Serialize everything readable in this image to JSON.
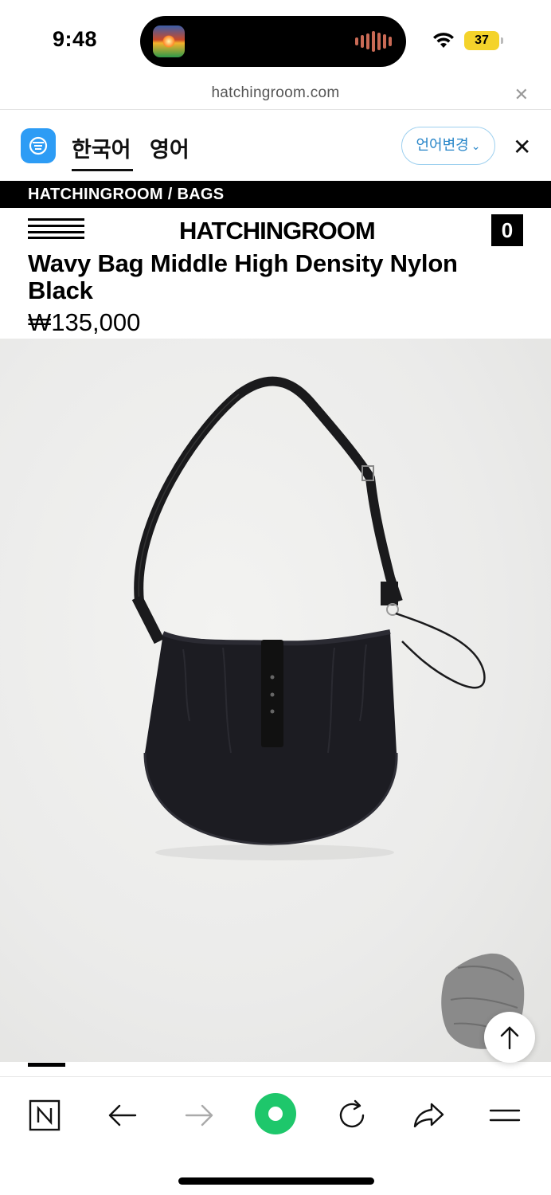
{
  "status_bar": {
    "time": "9:48",
    "battery_level": "37",
    "icons": [
      "music-app-icon",
      "audio-waveform-icon",
      "wifi-icon",
      "battery-icon"
    ],
    "battery_color": "#f4d32b"
  },
  "browser": {
    "url": "hatchingroom.com",
    "close_icon": "close-icon"
  },
  "translate_bar": {
    "app_icon": "papago-translate-icon",
    "tabs": [
      {
        "label": "한국어",
        "active": true
      },
      {
        "label": "영어",
        "active": false
      }
    ],
    "change_language_label": "언어변경",
    "accent_color": "#2886c9"
  },
  "site": {
    "breadcrumb": "HATCHINGROOM / BAGS",
    "logo": "HATCHINGROOM",
    "cart_count": "0"
  },
  "product": {
    "title": "Wavy Bag Middle High Density Nylon Black",
    "price": "₩135,000",
    "image_alt": "black nylon crossbody bag with leather strap"
  },
  "bottom_toolbar": {
    "items": [
      {
        "icon": "naver-n-icon"
      },
      {
        "icon": "back-arrow-icon"
      },
      {
        "icon": "forward-arrow-icon"
      },
      {
        "icon": "green-home-icon"
      },
      {
        "icon": "refresh-icon"
      },
      {
        "icon": "share-icon"
      },
      {
        "icon": "menu-icon"
      }
    ],
    "accent_color": "#1ec76b"
  }
}
